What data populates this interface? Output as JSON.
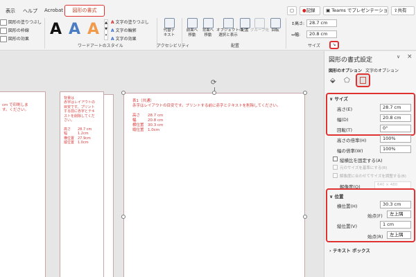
{
  "tabs": [
    "表示",
    "ヘルプ",
    "Acrobat"
  ],
  "active_tab": "図形の書式",
  "title_buttons": {
    "comment": "▢",
    "record": "記録",
    "teams": "Teams でプレゼンテーション",
    "share": "共有"
  },
  "shape_styles": {
    "fill": "図形の塗りつぶし",
    "outline": "図形の枠線",
    "effects": "図形の効果"
  },
  "wordart": {
    "letters": [
      "A",
      "A",
      "A"
    ],
    "text_fill": "文字の塗りつぶし",
    "text_outline": "文字の輪郭",
    "text_effects": "文字の効果",
    "group_label": "ワードアートのスタイル"
  },
  "accessibility": {
    "alt_text": "代替テ\nキスト",
    "group_label": "アクセシビリティ"
  },
  "arrange": {
    "bring_forward": "前面へ\n移動",
    "send_backward": "背面へ\n移動",
    "selection_pane": "オブジェクトの\n選択と表示",
    "align": "配置",
    "group": "グループ化",
    "rotate": "回転",
    "group_label": "配置"
  },
  "size_group": {
    "height_label": "高さ:",
    "height_value": "28.7 cm",
    "width_label": "幅:",
    "width_value": "20.8 cm",
    "group_label": "サイズ"
  },
  "slides": {
    "left_text": "cm で印刷しま\nす。ください。",
    "middle_text": "背景は\n赤字はレイアウトの\n目安です。プリント\nする前に赤字とテキ\nストを削除してくだ\nさい。\n\n高さ　　28.7 cm\n幅　　　1.2cm\n横位置　27.9cm\n縦位置　1.0cm",
    "main_text": "表1（共通）\n赤字はレイアウトの目安です。プリントする前に赤字とテキストを削除してください。\n\n高さ　　28.7 cm\n幅　　　20.8 cm\n横位置　30.3 cm\n縦位置　1.0cm"
  },
  "pane": {
    "title": "図形の書式設定",
    "tab_shape": "図形のオプション",
    "tab_text": "文字のオプション",
    "size_section": "サイズ",
    "height_label": "高さ(E)",
    "height_value": "28.7 cm",
    "width_label": "幅(D)",
    "width_value": "20.8 cm",
    "rotation_label": "回転(T)",
    "rotation_value": "0°",
    "scale_h_label": "高さの倍率(H)",
    "scale_h_value": "100%",
    "scale_w_label": "幅の倍率(W)",
    "scale_w_value": "100%",
    "lock_aspect": "縦横比を固定する(A)",
    "relative_to_original": "元のサイズを基準にする(R)",
    "best_scale": "解像度に合わせてサイズを調整する(B)",
    "resolution_label": "解像度(O)",
    "resolution_value": "640 × 480",
    "position_section": "位置",
    "horizontal_label": "横位置(H)",
    "horizontal_value": "30.3 cm",
    "from_label_1": "始点(F)",
    "from_value_1": "左上隅",
    "vertical_label": "縦位置(V)",
    "vertical_value": "1 cm",
    "from_label_2": "始点(R)",
    "from_value_2": "左上隅",
    "textbox_section": "テキスト ボックス",
    "close": "×",
    "collapse": "∨"
  }
}
